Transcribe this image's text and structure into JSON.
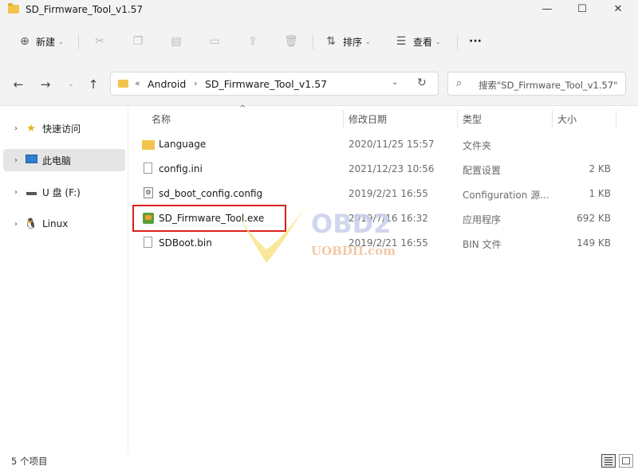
{
  "window": {
    "title": "SD_Firmware_Tool_v1.57",
    "minimize_glyph": "—",
    "maximize_glyph": "☐",
    "close_glyph": "✕"
  },
  "commandbar": {
    "new_label": "新建",
    "sort_label": "排序",
    "view_label": "查看",
    "more_glyph": "···"
  },
  "address": {
    "overflow_glyph": "«",
    "crumbs": [
      "Android",
      "SD_Firmware_Tool_v1.57"
    ],
    "search_placeholder": "搜索\"SD_Firmware_Tool_v1.57\""
  },
  "sidebar": {
    "items": [
      {
        "label": "快速访问",
        "icon": "star-icon"
      },
      {
        "label": "此电脑",
        "icon": "monitor-icon"
      },
      {
        "label": "U 盘 (F:)",
        "icon": "usb-drive-icon"
      },
      {
        "label": "Linux",
        "icon": "linux-penguin-icon"
      }
    ]
  },
  "columns": {
    "name": "名称",
    "modified": "修改日期",
    "type": "类型",
    "size": "大小"
  },
  "files": [
    {
      "name": "Language",
      "modified": "2020/11/25 15:57",
      "type": "文件夹",
      "size": "",
      "icon": "folder-icon"
    },
    {
      "name": "config.ini",
      "modified": "2021/12/23 10:56",
      "type": "配置设置",
      "size": "2 KB",
      "icon": "ini-file-icon"
    },
    {
      "name": "sd_boot_config.config",
      "modified": "2019/2/21 16:55",
      "type": "Configuration 源...",
      "size": "1 KB",
      "icon": "config-file-icon"
    },
    {
      "name": "SD_Firmware_Tool.exe",
      "modified": "2019/7/16 16:32",
      "type": "应用程序",
      "size": "692 KB",
      "icon": "exe-app-icon"
    },
    {
      "name": "SDBoot.bin",
      "modified": "2019/2/21 16:55",
      "type": "BIN 文件",
      "size": "149 KB",
      "icon": "bin-file-icon"
    }
  ],
  "watermark": {
    "brand": "OBD2",
    "site": "UOBDII.com"
  },
  "status": {
    "count_text": "5 个项目"
  },
  "colors": {
    "highlight": "#d8201c",
    "folder": "#f3c44d",
    "watermark_brand": "#c8d0ec",
    "watermark_site": "#f2c9a6"
  }
}
